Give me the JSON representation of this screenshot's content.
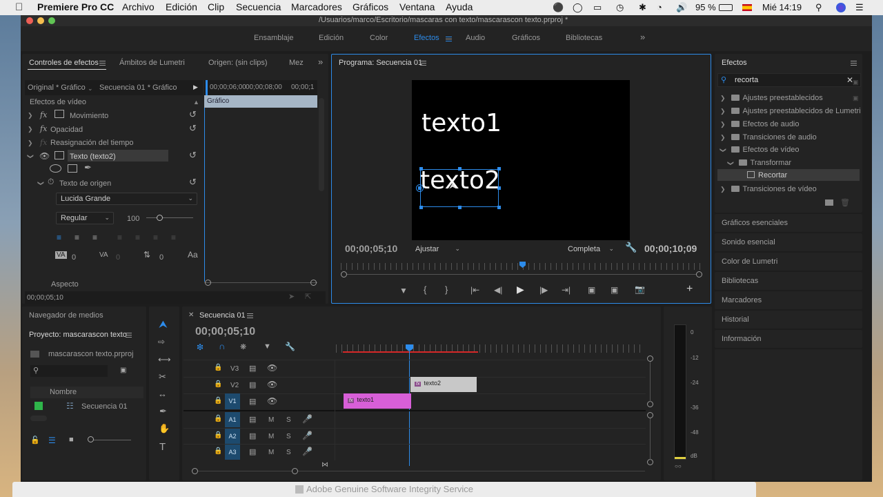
{
  "menubar": {
    "app": "Premiere Pro CC",
    "items": [
      "Archivo",
      "Edición",
      "Clip",
      "Secuencia",
      "Marcadores",
      "Gráficos",
      "Ventana",
      "Ayuda"
    ],
    "battery": "95 %",
    "clock": "Mié 14:19"
  },
  "window": {
    "title": "/Usuarios/marco/Escritorio/mascaras con texto/mascarascon texto.prproj *"
  },
  "workspaces": {
    "items": [
      "Ensamblaje",
      "Edición",
      "Color",
      "Efectos",
      "Audio",
      "Gráficos",
      "Bibliotecas"
    ],
    "active": "Efectos"
  },
  "effect_controls": {
    "tabs": [
      "Controles de efectos",
      "Ámbitos de Lumetri",
      "Origen: (sin clips)",
      "Mez"
    ],
    "source": "Original * Gráfico",
    "sequence": "Secuencia 01 * Gráfico",
    "ruler": [
      "00;00;06;00",
      "00;00;08;00",
      "00;00;1"
    ],
    "clip_label": "Gráfico",
    "section": "Efectos de vídeo",
    "rows": [
      "Movimiento",
      "Opacidad",
      "Reasignación del tiempo",
      "Texto (texto2)",
      "Texto de origen"
    ],
    "font": "Lucida Grande",
    "style": "Regular",
    "size": "100",
    "kerning": "0",
    "tracking": "0",
    "leading": "0",
    "aspect": "Aspecto",
    "timecode": "00;00;05;10"
  },
  "program": {
    "title": "Programa: Secuencia 01",
    "text1": "texto1",
    "text2": "texto2",
    "timecode": "00;00;05;10",
    "fit": "Ajustar",
    "quality": "Completa",
    "duration": "00;00;10;09",
    "playhead": 0.5
  },
  "effects_panel": {
    "title": "Efectos",
    "search": "recorta",
    "tree": [
      "Ajustes preestablecidos",
      "Ajustes preestablecidos de Lumetri",
      "Efectos de audio",
      "Transiciones de audio",
      "Efectos de vídeo",
      "Transformar",
      "Recortar",
      "Transiciones de vídeo"
    ],
    "sections": [
      "Gráficos esenciales",
      "Sonido esencial",
      "Color de Lumetri",
      "Bibliotecas",
      "Marcadores",
      "Historial",
      "Información"
    ]
  },
  "project": {
    "media_browser": "Navegador de medios",
    "title": "Proyecto: mascarascon texto",
    "file": "mascarascon texto.prproj",
    "column": "Nombre",
    "item": "Secuencia 01"
  },
  "timeline": {
    "title": "Secuencia 01",
    "timecode": "00;00;05;10",
    "video_tracks": [
      "V3",
      "V2",
      "V1"
    ],
    "audio_tracks": [
      "A1",
      "A2",
      "A3"
    ],
    "clips": [
      {
        "name": "texto2",
        "track": "V2"
      },
      {
        "name": "texto1",
        "track": "V1"
      }
    ],
    "mute": "M",
    "solo": "S"
  },
  "meter": {
    "labels": [
      "0",
      "-12",
      "-24",
      "-36",
      "-48",
      "dB"
    ]
  },
  "notice": "Adobe Genuine Software Integrity Service",
  "colors": {
    "accent": "#2d8ceb",
    "clip_v1": "#d85fd8",
    "clip_v2": "#c8c8c8",
    "track_active": "#1d4a6e",
    "inpoint": "#d72828"
  }
}
